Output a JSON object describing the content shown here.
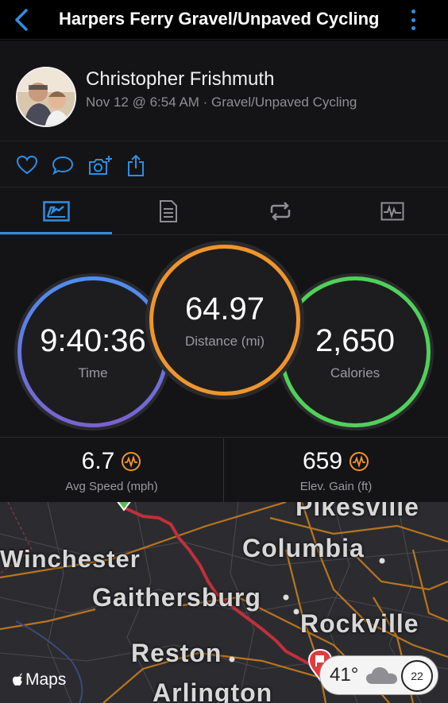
{
  "header": {
    "title": "Harpers Ferry Gravel/Unpaved Cycling",
    "back_icon": "chevron-left-icon",
    "more_icon": "more-vertical-icon"
  },
  "profile": {
    "name": "Christopher Frishmuth",
    "meta": "Nov 12 @ 6:54 AM · Gravel/Unpaved Cycling"
  },
  "actions": [
    "heart-icon",
    "comment-icon",
    "add-photo-icon",
    "share-icon"
  ],
  "tabs": [
    "overview-tab",
    "details-tab",
    "laps-tab",
    "charts-tab"
  ],
  "stats": {
    "time": {
      "value": "9:40:36",
      "label": "Time"
    },
    "distance": {
      "value": "64.97",
      "label": "Distance (mi)"
    },
    "calories": {
      "value": "2,650",
      "label": "Calories"
    }
  },
  "substats": {
    "speed": {
      "value": "6.7",
      "label": "Avg Speed (mph)"
    },
    "elevation": {
      "value": "659",
      "label": "Elev. Gain (ft)"
    }
  },
  "map": {
    "cities": {
      "pikesville": "Pikesville",
      "columbia": "Columbia",
      "winchester": "Winchester",
      "gaithersburg": "Gaithersburg",
      "rockville": "Rockville",
      "reston": "Reston",
      "arlington": "Arlington"
    },
    "attribution": "Maps",
    "weather": {
      "temp": "41°",
      "aqi": "22"
    }
  },
  "colors": {
    "accent": "#2f8ee5",
    "distance_ring": "#f0952c",
    "calories_ring": "#4fd15a",
    "time_ring_start": "#4f8ef0",
    "time_ring_end": "#7a62cf",
    "route": "#c0303a"
  }
}
